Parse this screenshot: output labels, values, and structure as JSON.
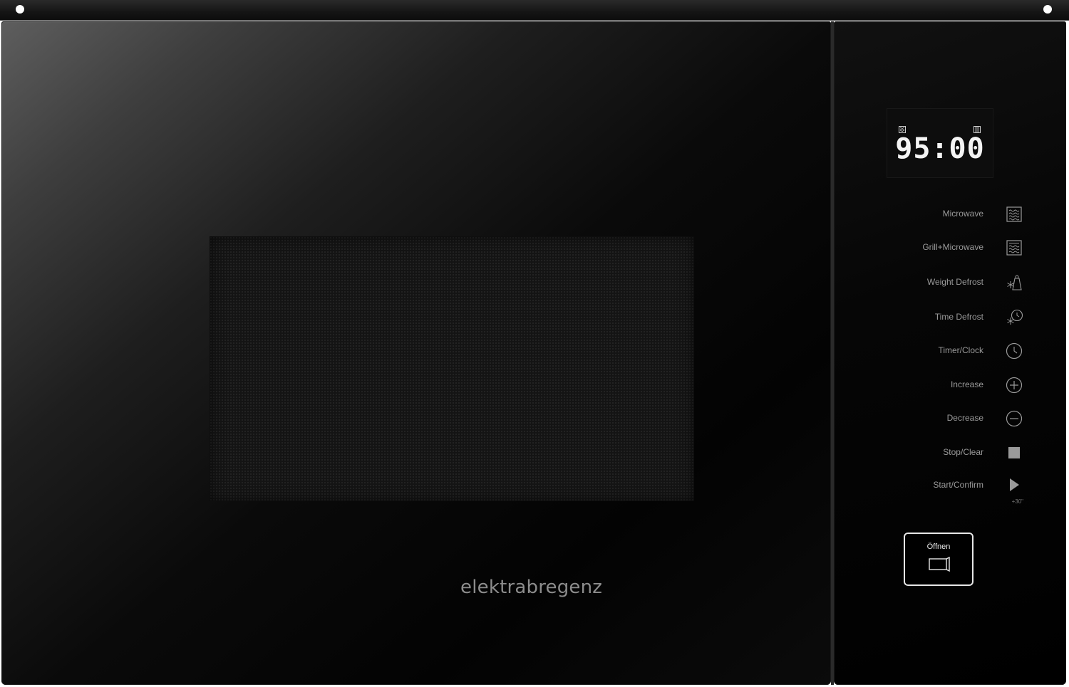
{
  "brand": "elektrabregenz",
  "display": {
    "time": "95:00"
  },
  "controls": [
    {
      "label": "Microwave",
      "icon": "microwave-waves-icon"
    },
    {
      "label": "Grill+Microwave",
      "icon": "grill-microwave-icon"
    },
    {
      "label": "Weight Defrost",
      "icon": "weight-defrost-icon"
    },
    {
      "label": "Time Defrost",
      "icon": "time-defrost-icon"
    },
    {
      "label": "Timer/Clock",
      "icon": "clock-icon"
    },
    {
      "label": "Increase",
      "icon": "plus-circle-icon"
    },
    {
      "label": "Decrease",
      "icon": "minus-circle-icon"
    },
    {
      "label": "Stop/Clear",
      "icon": "stop-square-icon"
    },
    {
      "label": "Start/Confirm",
      "icon": "play-triangle-icon",
      "sub": "+30\""
    }
  ],
  "open_button": {
    "label": "Öffnen",
    "icon": "door-open-icon"
  },
  "colors": {
    "label_text": "#9a9a9a",
    "display_text": "#f4f4f4",
    "brand_text": "#8c8c8c"
  }
}
